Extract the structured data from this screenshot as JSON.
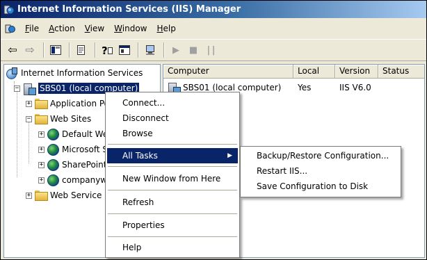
{
  "window": {
    "title": "Internet Information Services (IIS) Manager"
  },
  "menubar": {
    "items": [
      {
        "label": "File",
        "mnemonic": "F"
      },
      {
        "label": "Action",
        "mnemonic": "A"
      },
      {
        "label": "View",
        "mnemonic": "V"
      },
      {
        "label": "Window",
        "mnemonic": "W"
      },
      {
        "label": "Help",
        "mnemonic": "H"
      }
    ]
  },
  "toolbar": {
    "buttons": [
      "back-icon",
      "forward-icon",
      "show-hide-tree-icon",
      "export-list-icon",
      "help-icon",
      "properties-icon",
      "connect-computer-icon",
      "play-icon",
      "stop-icon",
      "pause-icon"
    ]
  },
  "tree": {
    "root": "Internet Information Services",
    "server": "SBS01 (local computer)",
    "app_pools": "Application Pools",
    "web_sites": "Web Sites",
    "sites": [
      "Default Web Site",
      "Microsoft SharePoint Administration",
      "SharePoint Central Administration",
      "companyweb"
    ],
    "web_service_ext": "Web Service Extensions"
  },
  "list": {
    "columns": [
      "Computer",
      "Local",
      "Version",
      "Status"
    ],
    "rows": [
      {
        "computer": "SBS01 (local computer)",
        "local": "Yes",
        "version": "IIS V6.0",
        "status": ""
      }
    ]
  },
  "context_menu": {
    "items": {
      "connect": "Connect...",
      "disconnect": "Disconnect",
      "browse": "Browse",
      "all_tasks": "All Tasks",
      "new_window": "New Window from Here",
      "refresh": "Refresh",
      "properties": "Properties",
      "help": "Help"
    }
  },
  "submenu": {
    "items": {
      "backup": "Backup/Restore Configuration...",
      "restart": "Restart IIS...",
      "save": "Save Configuration to Disk"
    }
  },
  "colors": {
    "selection": "#0a246a",
    "window_face": "#ece9d8"
  }
}
